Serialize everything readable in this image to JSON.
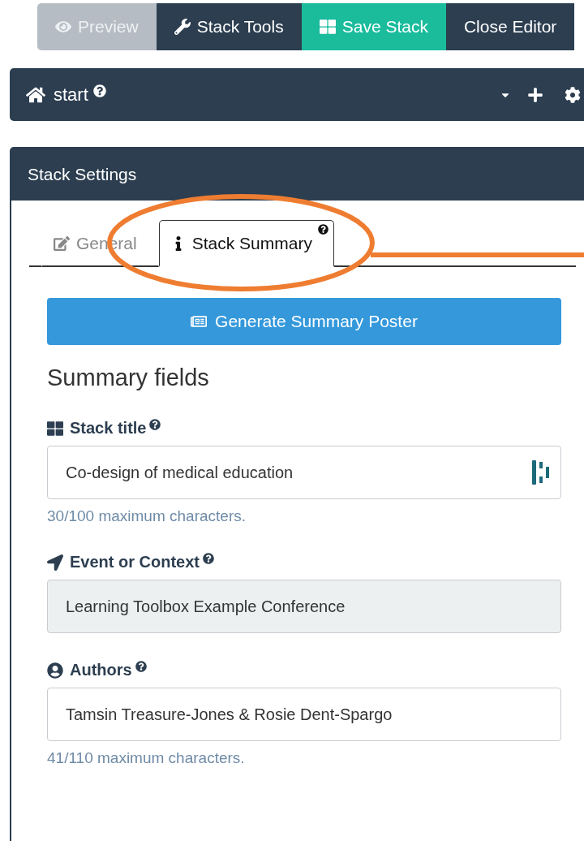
{
  "toolbar": {
    "buttons": [
      {
        "label": "Preview",
        "kind": "preview",
        "disabled": true
      },
      {
        "label": "Stack Tools",
        "kind": "tools",
        "disabled": false
      },
      {
        "label": "Save Stack",
        "kind": "save",
        "disabled": false
      },
      {
        "label": "Close Editor",
        "kind": "close",
        "disabled": false
      }
    ]
  },
  "start_bar": {
    "title": "start"
  },
  "panel": {
    "title": "Stack Settings",
    "tabs": [
      {
        "label": "General",
        "kind": "general",
        "selected": false
      },
      {
        "label": "Stack Summary",
        "kind": "summary",
        "selected": true
      }
    ],
    "action_button": "Generate Summary Poster",
    "heading": "Summary fields",
    "fields": [
      {
        "label": "Stack title",
        "kind": "title",
        "value": "Co-design of medical education",
        "disabled": false,
        "counter": "30/100 maximum characters."
      },
      {
        "label": "Event or Context",
        "kind": "event",
        "value": "Learning Toolbox Example Conference",
        "disabled": true
      },
      {
        "label": "Authors",
        "kind": "authors",
        "value": "Tamsin Treasure-Jones & Rosie Dent-Spargo",
        "disabled": false,
        "counter": "41/110 maximum characters."
      }
    ]
  }
}
